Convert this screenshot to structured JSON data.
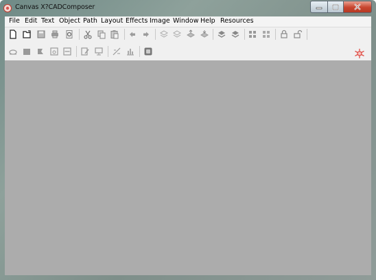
{
  "window": {
    "title": "Canvas X?CADComposer"
  },
  "menubar": {
    "items": [
      "File",
      "Edit",
      "Text",
      "Object",
      "Path",
      "Layout",
      "Effects",
      "Image",
      "Window",
      "Help",
      "Resources"
    ]
  },
  "colors": {
    "accent_icon": "#e0514a",
    "workspace": "#acacac"
  },
  "toolbars": {
    "row1_icons": [
      "new-document-icon",
      "open-icon",
      "save-icon",
      "print-icon",
      "print-preview-icon",
      "cut-icon",
      "copy-icon",
      "paste-icon",
      "undo-icon",
      "redo-icon",
      "layer-up-icon",
      "layer-down-icon",
      "bring-front-icon",
      "send-back-icon",
      "group-icon",
      "ungroup-icon",
      "align-icon",
      "distribute-icon",
      "lock-icon",
      "unlock-icon"
    ],
    "row2_icons": [
      "view-icon",
      "fill-icon",
      "effects-icon",
      "frame-icon",
      "fit-width-icon",
      "edit-icon",
      "display-icon",
      "measure-icon",
      "chart-icon",
      "capture-icon"
    ]
  }
}
